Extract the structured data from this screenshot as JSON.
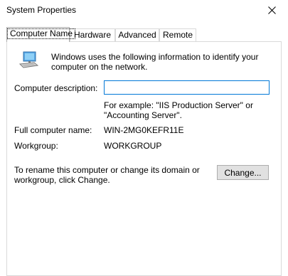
{
  "window": {
    "title": "System Properties",
    "close_icon": "close-icon"
  },
  "tabs": [
    {
      "label": "Computer Name",
      "active": true
    },
    {
      "label": "Hardware",
      "active": false
    },
    {
      "label": "Advanced",
      "active": false
    },
    {
      "label": "Remote",
      "active": false
    }
  ],
  "intro": {
    "icon": "computer-monitor-icon",
    "text": "Windows uses the following information to identify your computer on the network."
  },
  "description": {
    "label": "Computer description:",
    "value": "",
    "example": "For example: \"IIS Production Server\" or \"Accounting Server\"."
  },
  "full_name": {
    "label": "Full computer name:",
    "value": "WIN-2MG0KEFR11E"
  },
  "workgroup": {
    "label": "Workgroup:",
    "value": "WORKGROUP"
  },
  "rename": {
    "text": "To rename this computer or change its domain or workgroup, click Change.",
    "button_label": "Change..."
  },
  "colors": {
    "focus_border": "#0078d7",
    "button_bg": "#e1e1e1",
    "button_border": "#adadad",
    "tab_border": "#d9d9d9"
  }
}
